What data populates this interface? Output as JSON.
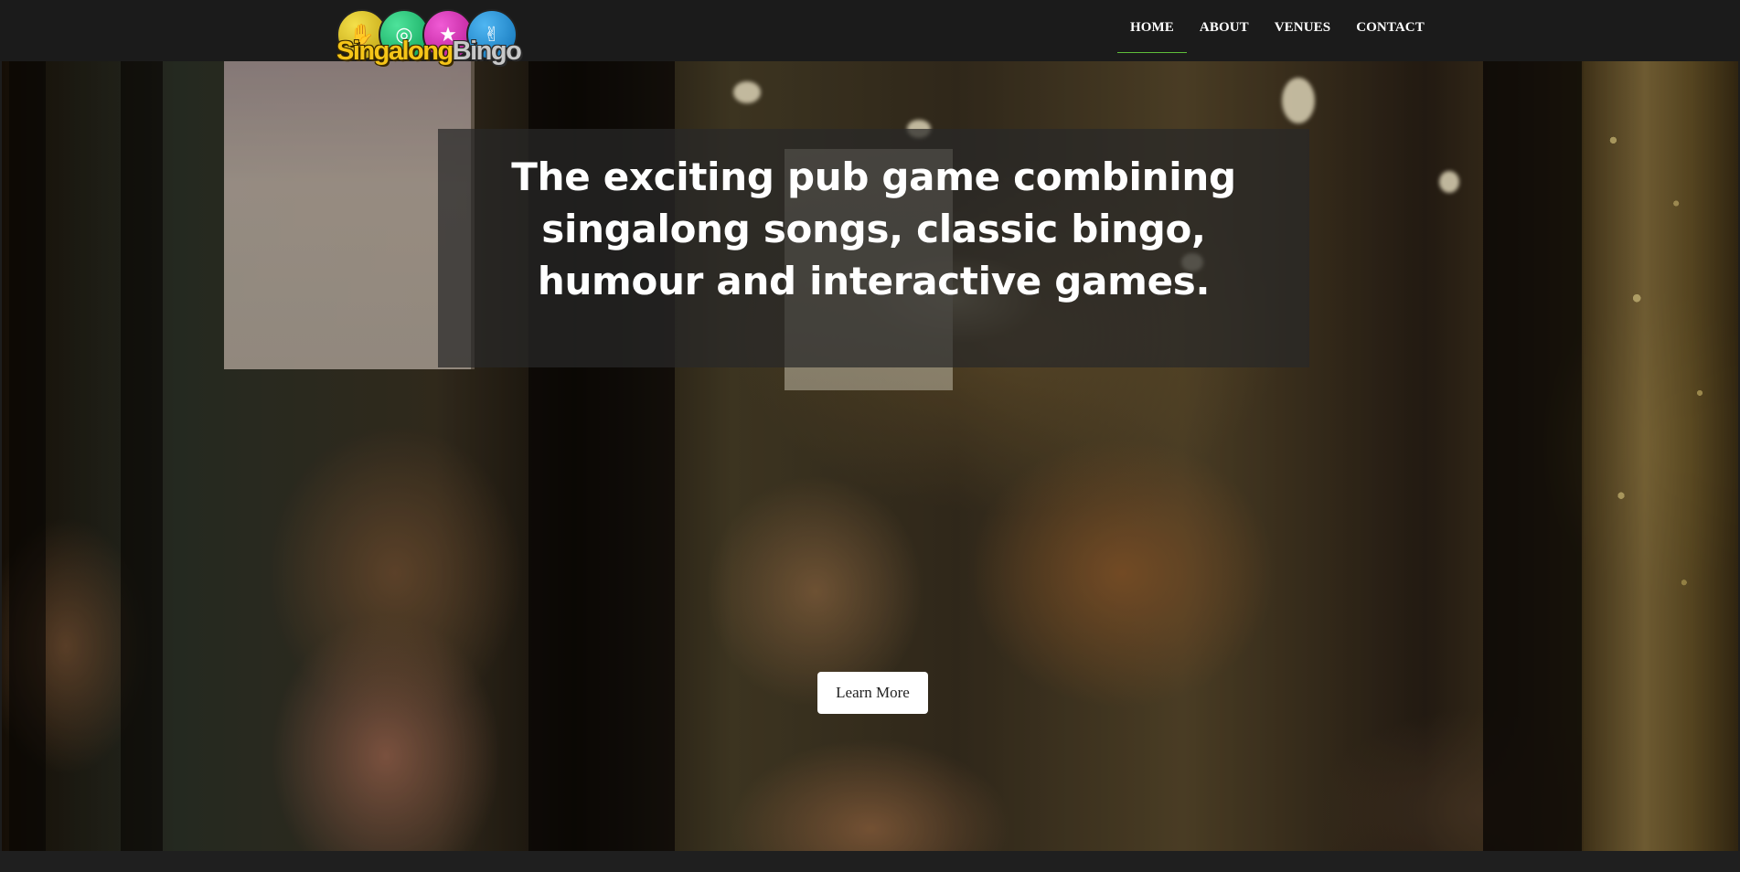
{
  "brand": {
    "logo_word_1": "Singalong",
    "logo_word_2": "Bingo",
    "ball_icons": [
      "hand-icon",
      "swirl-icon",
      "star-icon",
      "rock-hand-icon"
    ]
  },
  "nav": {
    "items": [
      {
        "label": "HOME",
        "active": true
      },
      {
        "label": "ABOUT",
        "active": false
      },
      {
        "label": "VENUES",
        "active": false
      },
      {
        "label": "CONTACT",
        "active": false
      }
    ],
    "active_underline_color": "#5fbf3a"
  },
  "hero": {
    "headline": "The exciting pub game combining singalong songs, classic bingo, humour and interactive games.",
    "cta_label": "Learn More"
  },
  "colors": {
    "topbar": "#1b1b1b",
    "ball_yellow": "#d9c21c",
    "ball_green": "#1ec27a",
    "ball_pink": "#d62fb4",
    "ball_blue": "#1f8fd6"
  }
}
